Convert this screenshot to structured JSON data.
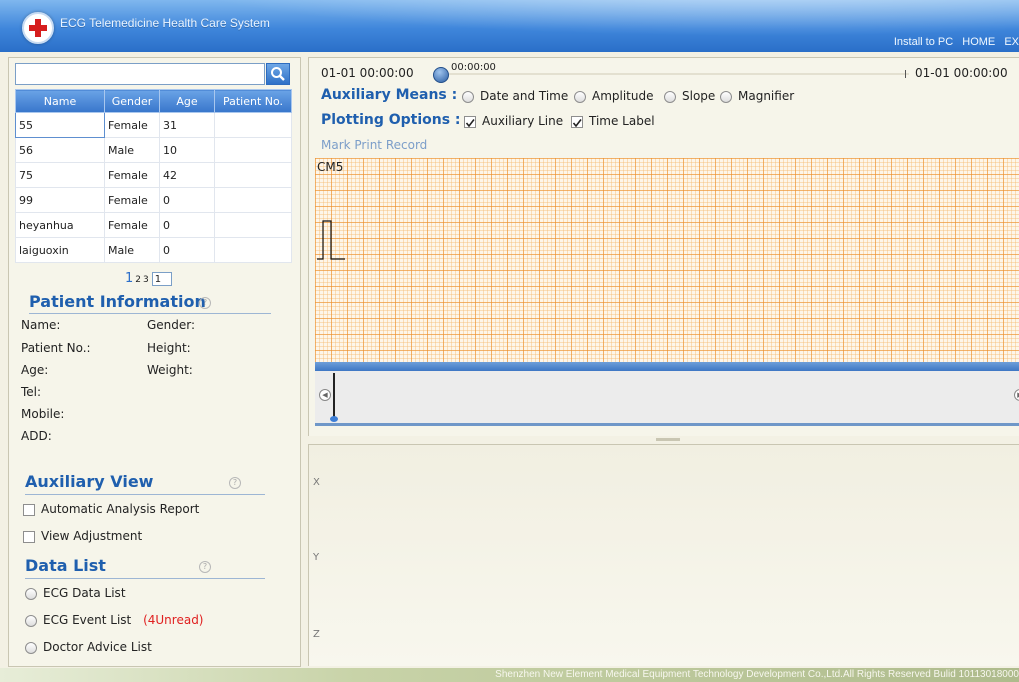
{
  "header": {
    "title": "ECG Telemedicine Health Care System",
    "links": [
      "Install to PC",
      "HOME",
      "EX"
    ]
  },
  "search": {
    "value": "",
    "placeholder": ""
  },
  "patient_table": {
    "columns": [
      "Name",
      "Gender",
      "Age",
      "Patient No."
    ],
    "rows": [
      {
        "name": "55",
        "gender": "Female",
        "age": "31",
        "patient_no": ""
      },
      {
        "name": "56",
        "gender": "Male",
        "age": "10",
        "patient_no": ""
      },
      {
        "name": "75",
        "gender": "Female",
        "age": "42",
        "patient_no": ""
      },
      {
        "name": "99",
        "gender": "Female",
        "age": "0",
        "patient_no": ""
      },
      {
        "name": "heyanhua",
        "gender": "Female",
        "age": "0",
        "patient_no": ""
      },
      {
        "name": "laiguoxin",
        "gender": "Male",
        "age": "0",
        "patient_no": ""
      }
    ]
  },
  "pager": {
    "current": "1",
    "pages": [
      "2",
      "3"
    ],
    "input_value": "1"
  },
  "patient_info": {
    "title": "Patient Information",
    "name_label": "Name:",
    "gender_label": "Gender:",
    "patient_no_label": "Patient No.:",
    "height_label": "Height:",
    "age_label": "Age:",
    "weight_label": "Weight:",
    "tel_label": "Tel:",
    "mobile_label": "Mobile:",
    "add_label": "ADD:"
  },
  "auxiliary_view": {
    "title": "Auxiliary View",
    "options": [
      {
        "label": "Automatic Analysis Report",
        "checked": false
      },
      {
        "label": "View Adjustment",
        "checked": false
      }
    ]
  },
  "data_list": {
    "title": "Data List",
    "items": [
      {
        "label": "ECG Data List",
        "badge": ""
      },
      {
        "label": "ECG Event List",
        "badge": "(4Unread)"
      },
      {
        "label": "Doctor Advice List",
        "badge": ""
      }
    ]
  },
  "timeline": {
    "start": "01-01 00:00:00",
    "current": "00:00:00",
    "end": "01-01 00:00:00"
  },
  "auxiliary_means": {
    "label": "Auxiliary Means :",
    "options": [
      "Date and Time",
      "Amplitude",
      "Slope",
      "Magnifier"
    ]
  },
  "plotting_options": {
    "label": "Plotting Options :",
    "options": [
      {
        "label": "Auxiliary Line",
        "checked": true
      },
      {
        "label": "Time Label",
        "checked": true
      }
    ]
  },
  "mark_print": "Mark Print Record",
  "ecg": {
    "lead": "CM5"
  },
  "axis_labels": [
    "X",
    "Y",
    "Z"
  ],
  "footer": {
    "text": "Shenzhen New Element Medical Equipment Technology Development Co.,Ltd.All Rights Reserved Bulid 10113018000"
  },
  "colors": {
    "header_blue": "#3f86db",
    "section_blue": "#1f5fae",
    "grid_orange": "#eb8c28",
    "unread_red": "#e02020"
  }
}
